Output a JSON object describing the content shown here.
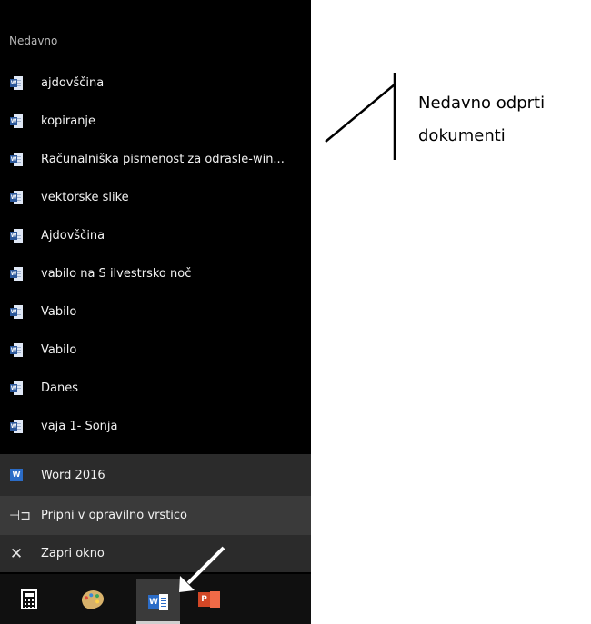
{
  "jumplist": {
    "section_title": "Nedavno",
    "recent": [
      {
        "label": "ajdovščina"
      },
      {
        "label": "kopiranje"
      },
      {
        "label": "Računalniška pismenost za odrasle-win..."
      },
      {
        "label": "vektorske slike"
      },
      {
        "label": "Ajdovščina"
      },
      {
        "label": "vabilo na S ilvestrsko noč"
      },
      {
        "label": "Vabilo"
      },
      {
        "label": "Vabilo"
      },
      {
        "label": "Danes"
      },
      {
        "label": "vaja 1- Sonja"
      }
    ],
    "actions": {
      "app_label": "Word 2016",
      "pin_label": "Pripni v opravilno vrstico",
      "close_label": "Zapri okno"
    }
  },
  "taskbar": {
    "icons": [
      "calculator-icon",
      "paint-icon",
      "word-icon",
      "powerpoint-icon"
    ]
  },
  "annotation": {
    "line1": "Nedavno odprti",
    "line2": "dokumenti"
  },
  "colors": {
    "panel_bg": "#000000",
    "app_row_bg": "#2b2b2b",
    "pin_row_bg": "#3a3a3a",
    "word_blue": "#2b579a",
    "powerpoint_red": "#d24726"
  }
}
